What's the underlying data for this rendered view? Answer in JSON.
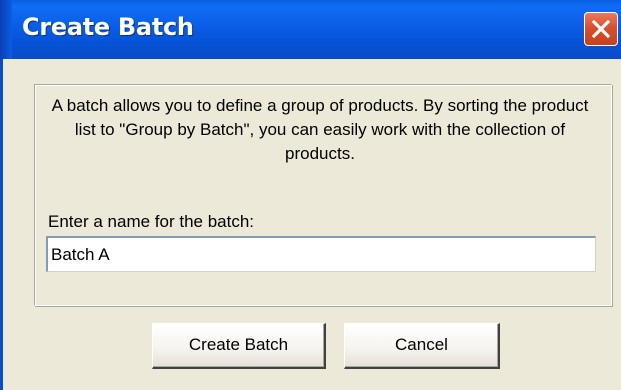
{
  "window": {
    "title": "Create Batch",
    "close_icon": "close-icon"
  },
  "dialog": {
    "description": "A batch allows you to define a group of products. By sorting the product list to \"Group by Batch\", you can easily work with the collection of products.",
    "field_label": "Enter a name for the batch:",
    "name_value": "Batch A"
  },
  "buttons": {
    "create_label": "Create Batch",
    "cancel_label": "Cancel"
  },
  "colors": {
    "titlebar": "#0a5ee0",
    "close_button": "#d9502e",
    "dialog_background": "#ece9d8"
  }
}
